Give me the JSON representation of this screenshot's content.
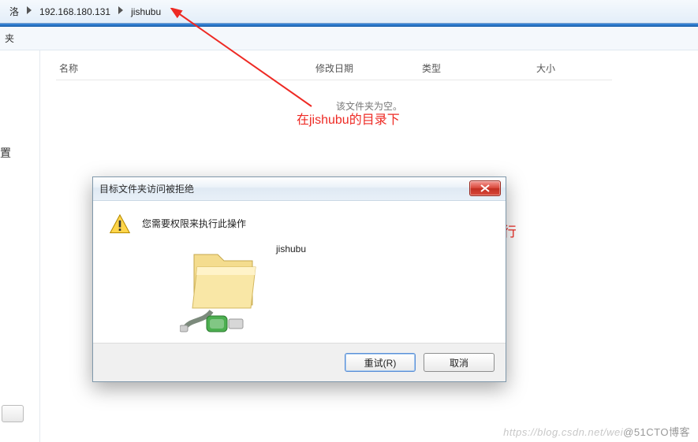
{
  "address": {
    "crumb1": "洛",
    "ip": "192.168.180.131",
    "folder": "jishubu"
  },
  "toolbar": {
    "label": "夹"
  },
  "columns": {
    "name": "名称",
    "date": "修改日期",
    "type": "类型",
    "size": "大小"
  },
  "list": {
    "empty": "该文件夹为空。"
  },
  "left": {
    "char": "置"
  },
  "annotations": {
    "line1": "在jishubu的目录下",
    "line2": "没有 权限执行"
  },
  "dialog": {
    "title": "目标文件夹访问被拒绝",
    "message": "您需要权限来执行此操作",
    "folder_name": "jishubu",
    "retry": "重试(R)",
    "cancel": "取消"
  },
  "watermark": {
    "faded": "https://blog.csdn.net/wei",
    "badge": "@51CTO博客"
  }
}
